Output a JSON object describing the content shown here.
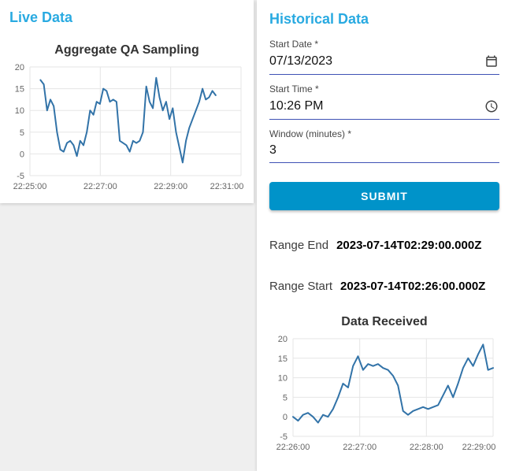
{
  "page": {
    "background": "#efefef"
  },
  "colors": {
    "accent_heading": "#29aae1",
    "submit_button": "#0093c9",
    "chart_line": "#3273a8",
    "input_underline": "#3f51b5"
  },
  "live_panel": {
    "heading": "Live Data"
  },
  "historical_panel": {
    "heading": "Historical Data",
    "form": {
      "start_date": {
        "label": "Start Date *",
        "value": "07/13/2023",
        "icon": "calendar-icon"
      },
      "start_time": {
        "label": "Start Time *",
        "value": "10:26 PM",
        "icon": "clock-icon"
      },
      "window_minutes": {
        "label": "Window (minutes) *",
        "value": "3"
      },
      "submit_label": "SUBMIT"
    },
    "range_end": {
      "label": "Range End",
      "value": "2023-07-14T02:29:00.000Z"
    },
    "range_start": {
      "label": "Range Start",
      "value": "2023-07-14T02:26:00.000Z"
    }
  },
  "chart_data": [
    {
      "type": "line",
      "title": "Aggregate QA Sampling",
      "xlabel": "",
      "ylabel": "",
      "ylim": [
        -5,
        20
      ],
      "y_ticks": [
        -5,
        0,
        5,
        10,
        15,
        20
      ],
      "x_axis_range": [
        "22:25:00",
        "22:31:00"
      ],
      "x_tick_labels": [
        "22:25:00",
        "22:27:00",
        "22:29:00",
        "22:31:00"
      ],
      "x_tick_positions": [
        0,
        0.3333,
        0.6667,
        1
      ],
      "data_x_range_fraction": [
        0.05,
        0.88
      ],
      "legend": "none",
      "grid": true,
      "grid_color": "#e5e5e5",
      "line_color": "#3273a8",
      "values": [
        17,
        16,
        10,
        12.5,
        11,
        5,
        1,
        0.5,
        2.5,
        3,
        2,
        -0.5,
        3,
        2,
        5,
        10,
        9,
        12,
        11.5,
        15,
        14.5,
        12,
        12.5,
        12,
        3,
        2.5,
        2,
        0.5,
        3,
        2.5,
        3,
        5,
        15.5,
        12,
        10.5,
        17.5,
        13,
        10,
        12,
        8,
        10.5,
        5,
        1.5,
        -2,
        3,
        6,
        8,
        10,
        12,
        15,
        12.5,
        13,
        14.5,
        13.5
      ]
    },
    {
      "type": "line",
      "title": "Data Received",
      "xlabel": "",
      "ylabel": "",
      "ylim": [
        -5,
        20
      ],
      "y_ticks": [
        -5,
        0,
        5,
        10,
        15,
        20
      ],
      "x_axis_range": [
        "22:26:00",
        "22:29:00"
      ],
      "x_tick_labels": [
        "22:26:00",
        "22:27:00",
        "22:28:00",
        "22:29:00"
      ],
      "x_tick_positions": [
        0,
        0.3333,
        0.6667,
        1
      ],
      "data_x_range_fraction": [
        0,
        1
      ],
      "legend": "none",
      "grid": true,
      "grid_color": "#e5e5e5",
      "line_color": "#3273a8",
      "values": [
        0,
        -1,
        0.5,
        1,
        0,
        -1.5,
        0.5,
        0,
        2,
        5,
        8.5,
        7.5,
        13,
        15.5,
        12,
        13.5,
        13,
        13.5,
        12.5,
        12,
        10.5,
        8,
        1.5,
        0.5,
        1.5,
        2,
        2.5,
        2,
        2.5,
        3,
        5.5,
        8,
        5,
        8.5,
        12.5,
        15,
        13,
        16,
        18.5,
        12,
        12.5
      ]
    }
  ]
}
